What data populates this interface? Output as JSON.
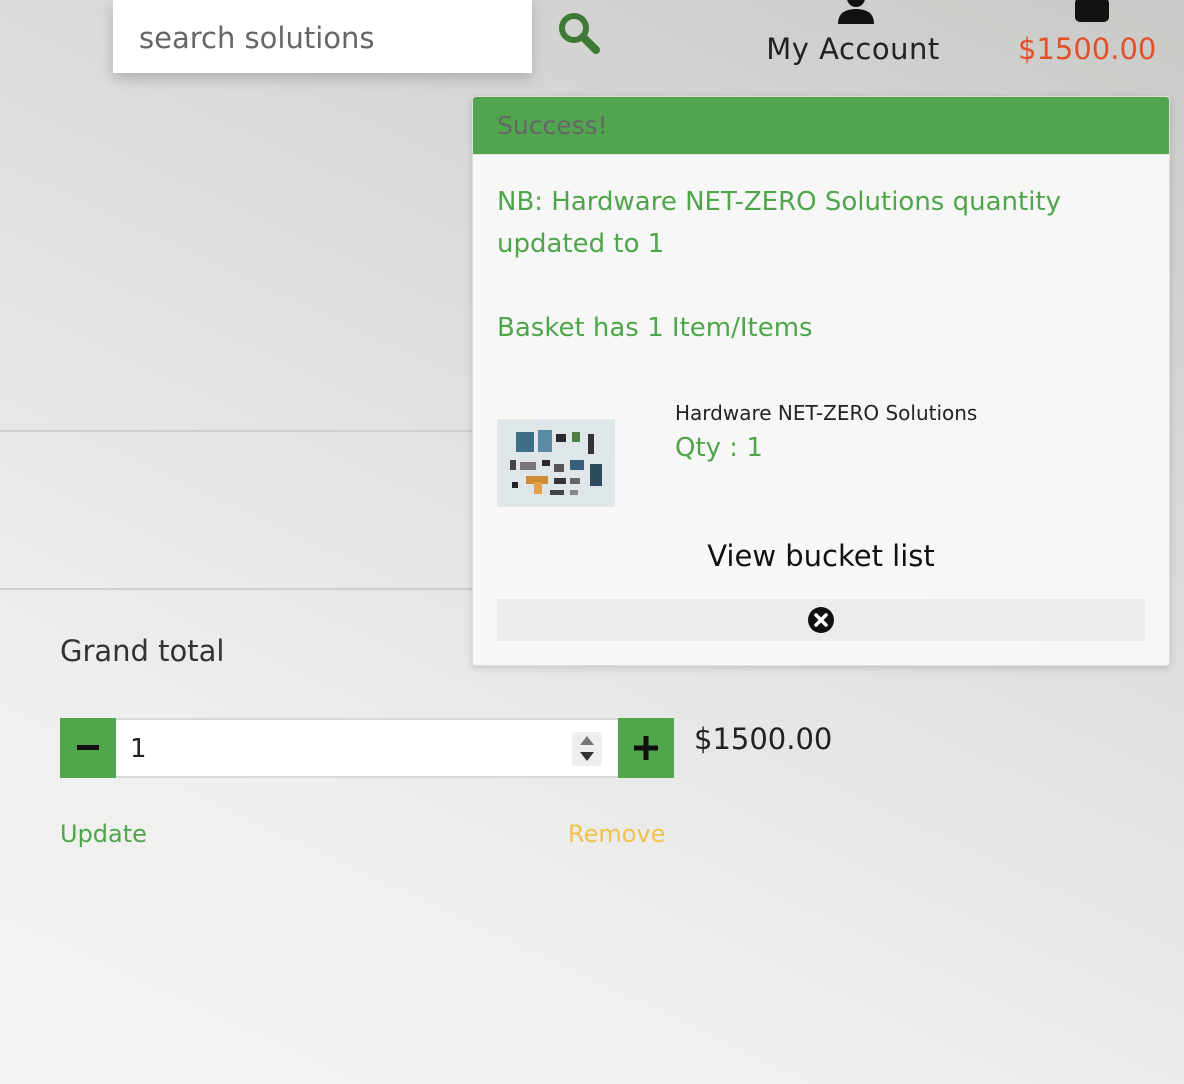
{
  "header": {
    "search_placeholder": "search solutions",
    "account_label": "My Account",
    "basket_total": "$1500.00"
  },
  "cart": {
    "grand_total_label": "Grand total",
    "quantity": "1",
    "line_price": "$1500.00",
    "update_label": "Update",
    "remove_label": "Remove"
  },
  "toast": {
    "title": "Success!",
    "message": "NB: Hardware NET-ZERO Solutions quantity updated to 1",
    "count_text": "Basket has 1 Item/Items",
    "item_name": "Hardware NET-ZERO Solutions",
    "item_qty": "Qty : 1",
    "view_label": "View bucket list"
  },
  "colors": {
    "accent_green": "#51a54d",
    "price_orange": "#e3512a",
    "remove_yellow": "#f0c24a"
  },
  "icons": {
    "search": "search-icon",
    "account": "user-icon",
    "basket": "shopping-bag-icon",
    "minus": "minus-icon",
    "plus": "plus-icon",
    "close": "close-circle-icon"
  }
}
